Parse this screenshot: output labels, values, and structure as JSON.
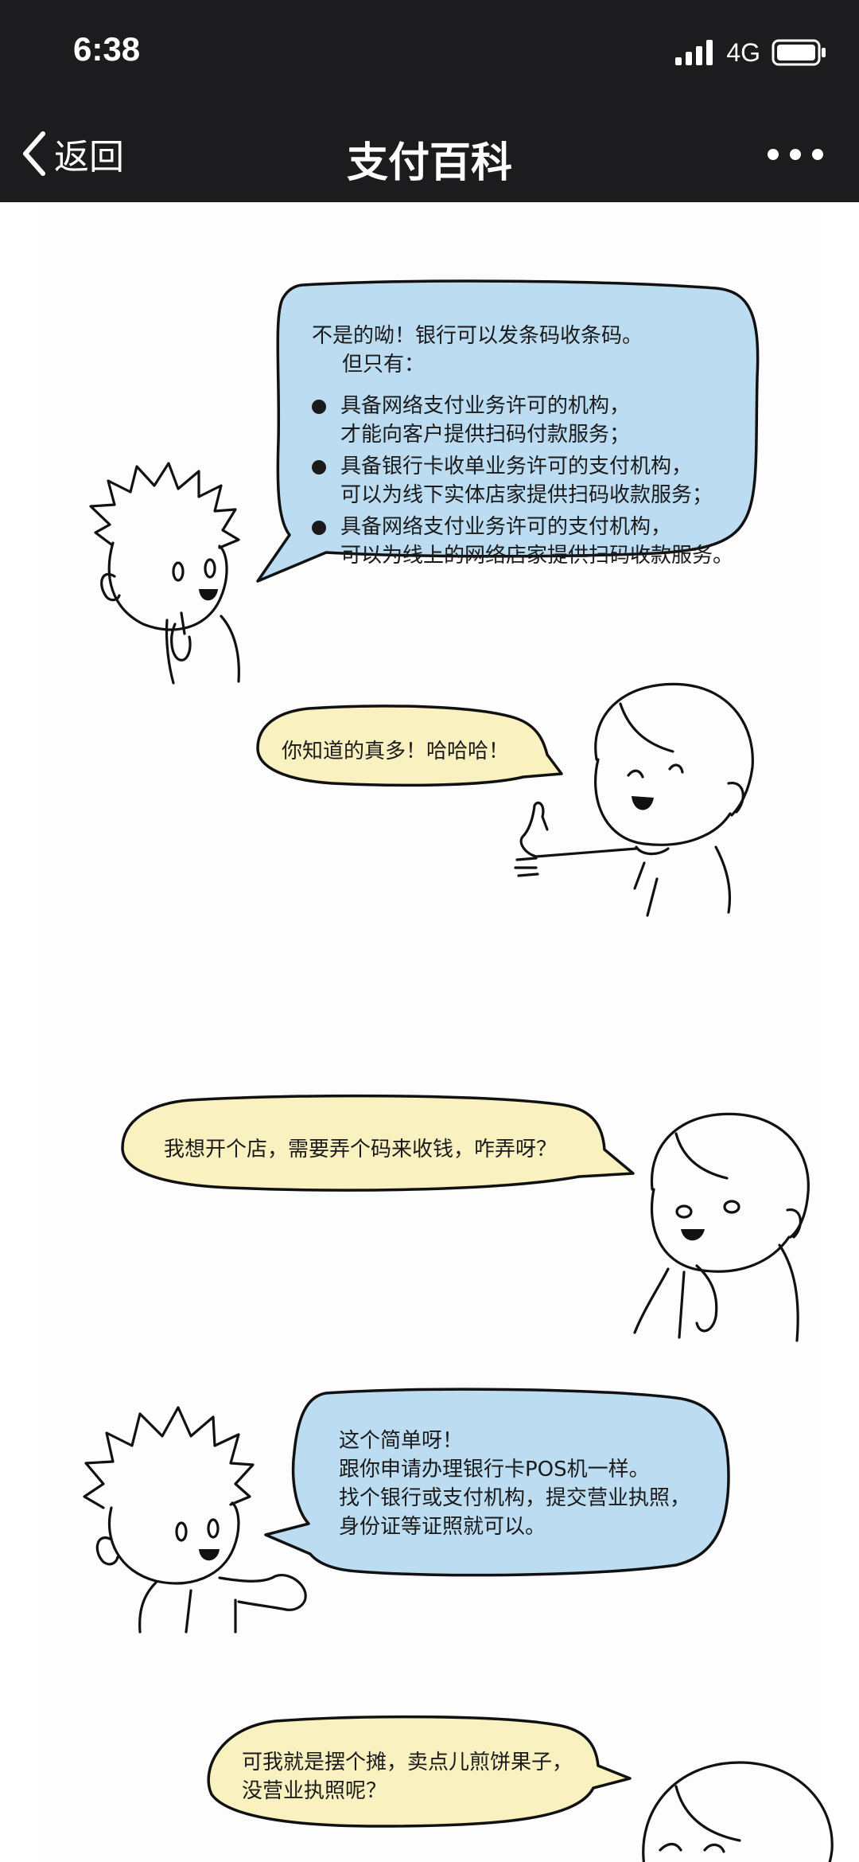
{
  "status_bar": {
    "time": "6:38",
    "network": "4G"
  },
  "nav": {
    "back_label": "返回",
    "title": "支付百科"
  },
  "comic": {
    "bubble1": {
      "intro_line1": "不是的呦！银行可以发条码收条码。",
      "intro_line2": "但只有：",
      "bullets": [
        {
          "line1": "具备网络支付业务许可的机构，",
          "line2": "才能向客户提供扫码付款服务；"
        },
        {
          "line1": "具备银行卡收单业务许可的支付机构，",
          "line2": "可以为线下实体店家提供扫码收款服务；"
        },
        {
          "line1": "具备网络支付业务许可的支付机构，",
          "line2": "可以为线上的网络店家提供扫码收款服务。"
        }
      ]
    },
    "bubble2": {
      "text": "你知道的真多！哈哈哈！"
    },
    "bubble3": {
      "text": "我想开个店，需要弄个码来收钱，咋弄呀？"
    },
    "bubble4": {
      "line1": "这个简单呀！",
      "line2": "跟你申请办理银行卡POS机一样。",
      "line3": "找个银行或支付机构，提交营业执照，",
      "line4": "身份证等证照就可以。"
    },
    "bubble5": {
      "line1": "可我就是摆个摊，卖点儿煎饼果子，",
      "line2": "没营业执照呢？"
    }
  },
  "colors": {
    "bar_background": "#1c1c1e",
    "blue_bubble": "#bcdcf1",
    "yellow_bubble": "#faf1c0"
  }
}
